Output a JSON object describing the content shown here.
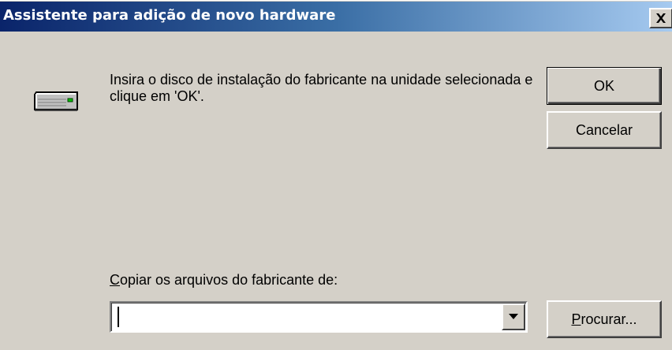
{
  "window": {
    "title": "Assistente para adição de novo hardware",
    "close_glyph": "×"
  },
  "body": {
    "message": "Insira o disco de instalação do fabricante na unidade selecionada e clique em 'OK'.",
    "icon": "disk-drive-icon"
  },
  "buttons": {
    "ok": "OK",
    "cancel": "Cancelar",
    "browse": "Procurar..."
  },
  "copy_from": {
    "label": "Copiar os arquivos do fabricante de:",
    "value": "",
    "placeholder": ""
  },
  "colors": {
    "dialog_face": "#d4d0c8",
    "titlebar_start": "#0a246a",
    "titlebar_end": "#a6caf0",
    "title_text": "#ffffff"
  }
}
